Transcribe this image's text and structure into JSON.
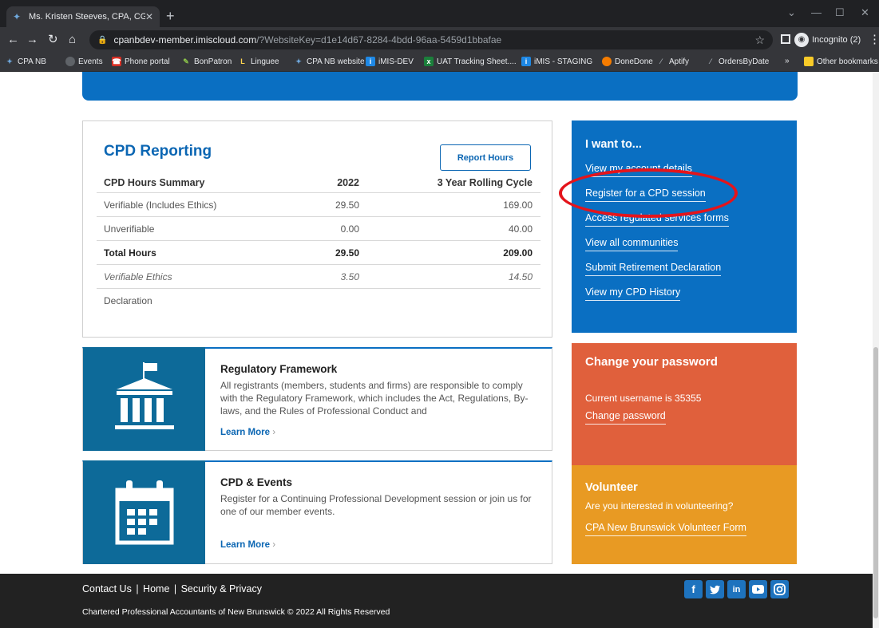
{
  "browser": {
    "tab_title": "Ms. Kristen Steeves, CPA, CGA",
    "url_host": "cpanbdev-member.imiscloud.com",
    "url_rest": "/?WebsiteKey=d1e14d67-8284-4bdd-96aa-5459d1bbafae",
    "profile_label": "Incognito (2)",
    "bookmarks": [
      "CPA NB",
      "Events",
      "Phone portal",
      "BonPatron",
      "Linguee",
      "CPA NB website",
      "iMIS-DEV",
      "UAT Tracking Sheet....",
      "iMIS - STAGING",
      "DoneDone",
      "Aptify",
      "OrdersByDate"
    ],
    "overflow": "»",
    "other_bookmarks": "Other bookmarks"
  },
  "cpd": {
    "title": "CPD Reporting",
    "report_button": "Report Hours",
    "headers": [
      "CPD Hours Summary",
      "2022",
      "3 Year Rolling Cycle"
    ],
    "rows": [
      [
        "Verifiable (Includes Ethics)",
        "29.50",
        "169.00"
      ],
      [
        "Unverifiable",
        "0.00",
        "40.00"
      ],
      [
        "Total Hours",
        "29.50",
        "209.00"
      ],
      [
        "Verifiable Ethics",
        "3.50",
        "14.50"
      ],
      [
        "Declaration",
        "",
        ""
      ]
    ]
  },
  "regulatory": {
    "title": "Regulatory Framework",
    "text": "All registrants (members, students and firms) are responsible to comply with the Regulatory Framework, which includes the Act, Regulations, By-laws, and the Rules of Professional Conduct and",
    "learn_more": "Learn More"
  },
  "events": {
    "title": "CPD & Events",
    "text": "Register for a Continuing Professional Development session or join us for one of our member events.",
    "learn_more": "Learn More"
  },
  "want": {
    "title": "I want to...",
    "links": [
      "View my account details",
      "Register for a CPD session",
      "Access regulated services forms",
      "View all communities",
      "Submit Retirement Declaration",
      "View my CPD History"
    ]
  },
  "password": {
    "title": "Change your password",
    "username_text": "Current username is  35355",
    "link": "Change password"
  },
  "volunteer": {
    "title": "Volunteer",
    "text": "Are you interested in volunteering?",
    "link": "CPA New Brunswick Volunteer Form"
  },
  "footer": {
    "links": [
      "Contact Us",
      "Home",
      "Security & Privacy"
    ],
    "copyright": "Chartered Professional Accountants of New Brunswick © 2022 All Rights Reserved",
    "socials": [
      "facebook-icon",
      "twitter-icon",
      "linkedin-icon",
      "youtube-icon",
      "instagram-icon"
    ]
  },
  "colors": {
    "brand_blue": "#0a6fc2",
    "password_orange": "#e0603c",
    "volunteer_amber": "#e89a23",
    "annotation_red": "#e4141b"
  }
}
